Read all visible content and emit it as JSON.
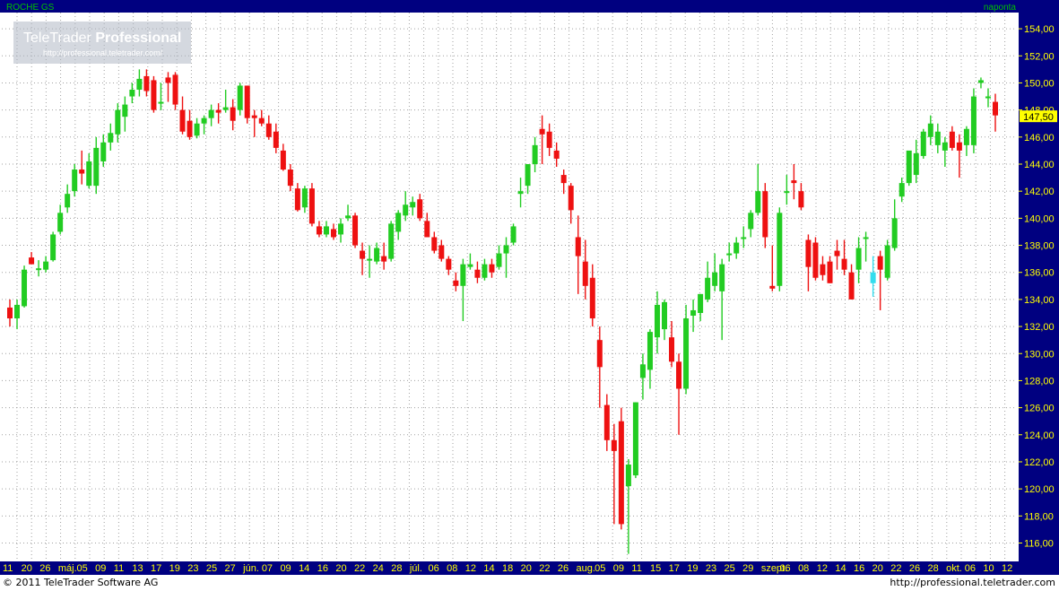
{
  "header": {
    "symbol": "ROCHE GS",
    "period": "naponta"
  },
  "watermark": {
    "brand_light": "TeleTrader",
    "brand_bold": "Professional",
    "url": "http://professional.teletrader.com/"
  },
  "footer": {
    "copyright": "© 2011  TeleTrader Software AG",
    "url": "http://professional.teletrader.com"
  },
  "colors": {
    "background": "#ffffff",
    "frame": "#000080",
    "axis_text": "#ffff00",
    "header_text": "#00c000",
    "up": "#22cc22",
    "down": "#ee1111",
    "last": "#33ddee",
    "grid": "#a0a0a0",
    "last_price_bg": "#ffff00"
  },
  "chart_data": {
    "type": "candlestick",
    "title": "ROCHE GS",
    "ylim": [
      115,
      155
    ],
    "y_ticks": [
      "154,00",
      "152,00",
      "150,00",
      "148,00",
      "146,00",
      "144,00",
      "142,00",
      "140,00",
      "138,00",
      "136,00",
      "134,00",
      "132,00",
      "130,00",
      "128,00",
      "126,00",
      "124,00",
      "122,00",
      "120,00",
      "118,00",
      "116,00"
    ],
    "x_ticks": [
      "11",
      "20",
      "26",
      "máj.",
      "05",
      "09",
      "11",
      "13",
      "17",
      "19",
      "23",
      "25",
      "27",
      "jún.",
      "07",
      "09",
      "14",
      "16",
      "20",
      "22",
      "24",
      "28",
      "júl.",
      "06",
      "08",
      "12",
      "14",
      "18",
      "20",
      "22",
      "26",
      "aug.",
      "05",
      "09",
      "11",
      "15",
      "17",
      "19",
      "23",
      "25",
      "29",
      "szept.",
      "06",
      "08",
      "12",
      "14",
      "16",
      "20",
      "22",
      "26",
      "28",
      "okt.",
      "06",
      "10",
      "12"
    ],
    "last_price": "147,50",
    "grid": true,
    "candles": [
      [
        133.4,
        134.0,
        132.0,
        132.6
      ],
      [
        132.6,
        134.0,
        131.8,
        133.6
      ],
      [
        133.5,
        136.5,
        133.4,
        136.2
      ],
      [
        137.1,
        137.5,
        136.6,
        136.6
      ],
      [
        136.3,
        136.9,
        135.7,
        136.3
      ],
      [
        136.2,
        137.2,
        136.0,
        136.8
      ],
      [
        136.9,
        139.0,
        136.8,
        138.8
      ],
      [
        139.0,
        141.0,
        138.8,
        140.4
      ],
      [
        140.8,
        142.5,
        140.4,
        141.8
      ],
      [
        142.0,
        144.0,
        141.6,
        143.6
      ],
      [
        143.6,
        145.0,
        142.5,
        143.3
      ],
      [
        142.4,
        144.8,
        142.2,
        144.2
      ],
      [
        142.4,
        146.0,
        141.8,
        145.2
      ],
      [
        144.2,
        146.2,
        143.8,
        145.6
      ],
      [
        145.6,
        147.0,
        145.0,
        146.3
      ],
      [
        146.2,
        148.5,
        145.6,
        148.0
      ],
      [
        147.5,
        149.0,
        146.4,
        148.4
      ],
      [
        149.0,
        150.0,
        148.5,
        149.5
      ],
      [
        149.5,
        151.0,
        149.0,
        150.3
      ],
      [
        150.5,
        151.0,
        149.0,
        149.4
      ],
      [
        150.2,
        150.5,
        147.8,
        148.0
      ],
      [
        148.6,
        150.0,
        148.0,
        148.6
      ],
      [
        150.4,
        150.8,
        148.6,
        150.0
      ],
      [
        150.6,
        150.8,
        148.0,
        148.4
      ],
      [
        148.0,
        149.0,
        146.2,
        146.4
      ],
      [
        147.2,
        148.0,
        145.8,
        146.0
      ],
      [
        146.1,
        147.4,
        145.9,
        147.0
      ],
      [
        147.0,
        147.6,
        146.2,
        147.4
      ],
      [
        147.4,
        148.4,
        146.8,
        148.0
      ],
      [
        148.0,
        148.5,
        147.0,
        147.8
      ],
      [
        148.0,
        149.5,
        147.8,
        148.2
      ],
      [
        148.2,
        148.8,
        146.5,
        147.2
      ],
      [
        148.0,
        150.0,
        147.6,
        149.8
      ],
      [
        149.8,
        149.8,
        147.0,
        147.4
      ],
      [
        147.6,
        148.0,
        146.0,
        147.4
      ],
      [
        147.4,
        148.0,
        146.8,
        147.0
      ],
      [
        147.0,
        147.6,
        145.8,
        146.0
      ],
      [
        146.4,
        147.0,
        144.8,
        145.2
      ],
      [
        145.0,
        145.5,
        143.5,
        143.6
      ],
      [
        143.6,
        144.0,
        142.0,
        142.4
      ],
      [
        142.2,
        142.6,
        140.5,
        140.6
      ],
      [
        140.8,
        142.4,
        140.4,
        142.2
      ],
      [
        142.2,
        142.6,
        139.4,
        139.6
      ],
      [
        139.4,
        139.8,
        138.6,
        138.8
      ],
      [
        138.8,
        139.8,
        138.6,
        139.4
      ],
      [
        139.2,
        139.6,
        138.4,
        138.6
      ],
      [
        138.8,
        140.0,
        138.2,
        139.6
      ],
      [
        140.0,
        141.0,
        139.8,
        140.2
      ],
      [
        140.2,
        140.4,
        137.8,
        138.0
      ],
      [
        137.6,
        138.2,
        135.8,
        137.0
      ],
      [
        137.0,
        138.0,
        135.6,
        137.0
      ],
      [
        136.8,
        138.2,
        136.6,
        137.8
      ],
      [
        137.2,
        138.2,
        136.2,
        136.8
      ],
      [
        137.0,
        139.8,
        136.8,
        139.6
      ],
      [
        139.0,
        140.6,
        138.4,
        140.4
      ],
      [
        140.2,
        142.0,
        139.8,
        141.0
      ],
      [
        140.8,
        141.6,
        140.2,
        141.2
      ],
      [
        141.4,
        141.8,
        139.8,
        140.0
      ],
      [
        139.8,
        140.4,
        138.6,
        138.6
      ],
      [
        138.6,
        139.0,
        137.4,
        137.6
      ],
      [
        138.0,
        138.4,
        136.8,
        137.0
      ],
      [
        137.0,
        137.2,
        135.8,
        136.2
      ],
      [
        135.4,
        136.0,
        134.6,
        135.0
      ],
      [
        135.0,
        137.0,
        132.4,
        136.6
      ],
      [
        136.4,
        137.4,
        136.2,
        136.6
      ],
      [
        136.2,
        136.8,
        135.2,
        135.6
      ],
      [
        135.6,
        137.0,
        135.4,
        136.6
      ],
      [
        136.6,
        137.0,
        135.6,
        136.0
      ],
      [
        136.4,
        138.0,
        136.2,
        137.4
      ],
      [
        137.4,
        138.6,
        135.6,
        138.0
      ],
      [
        138.2,
        139.6,
        138.0,
        139.4
      ],
      [
        141.8,
        143.0,
        140.8,
        142.0
      ],
      [
        142.4,
        144.0,
        141.8,
        144.0
      ],
      [
        144.0,
        146.0,
        143.4,
        145.4
      ],
      [
        146.6,
        147.6,
        144.0,
        146.2
      ],
      [
        146.4,
        147.0,
        144.6,
        145.2
      ],
      [
        145.0,
        145.6,
        143.8,
        144.4
      ],
      [
        143.2,
        143.6,
        141.8,
        142.6
      ],
      [
        142.4,
        142.6,
        139.6,
        140.6
      ],
      [
        138.6,
        140.2,
        134.4,
        137.2
      ],
      [
        136.8,
        138.4,
        134.0,
        135.0
      ],
      [
        135.6,
        136.6,
        132.0,
        132.6
      ],
      [
        131.0,
        132.0,
        126.0,
        129.0
      ],
      [
        126.2,
        127.0,
        122.8,
        123.6
      ],
      [
        123.6,
        124.8,
        117.4,
        122.8
      ],
      [
        125.0,
        126.0,
        117.0,
        117.4
      ],
      [
        120.2,
        122.2,
        115.2,
        121.8
      ],
      [
        121.0,
        126.4,
        120.8,
        126.4
      ],
      [
        128.2,
        130.0,
        126.6,
        129.2
      ],
      [
        128.8,
        131.8,
        127.4,
        131.6
      ],
      [
        131.2,
        134.6,
        130.0,
        133.6
      ],
      [
        131.8,
        134.0,
        131.0,
        133.8
      ],
      [
        131.2,
        132.4,
        129.0,
        129.4
      ],
      [
        129.4,
        130.0,
        124.0,
        127.4
      ],
      [
        127.4,
        133.6,
        127.0,
        132.6
      ],
      [
        132.8,
        134.0,
        131.6,
        133.2
      ],
      [
        133.0,
        134.4,
        132.4,
        134.4
      ],
      [
        134.0,
        136.8,
        133.8,
        135.6
      ],
      [
        135.0,
        137.4,
        134.6,
        136.0
      ],
      [
        134.6,
        137.0,
        131.0,
        136.6
      ],
      [
        137.4,
        138.2,
        136.8,
        137.4
      ],
      [
        137.4,
        138.6,
        137.0,
        138.2
      ],
      [
        138.6,
        139.4,
        137.8,
        138.6
      ],
      [
        139.2,
        140.6,
        138.6,
        140.4
      ],
      [
        140.4,
        144.0,
        140.2,
        142.0
      ],
      [
        142.0,
        142.6,
        137.8,
        138.6
      ],
      [
        135.0,
        138.0,
        134.6,
        134.8
      ],
      [
        135.0,
        140.8,
        134.6,
        140.4
      ],
      [
        142.0,
        143.2,
        141.0,
        142.0
      ],
      [
        142.8,
        144.0,
        141.4,
        142.6
      ],
      [
        142.0,
        142.6,
        140.6,
        140.8
      ],
      [
        138.4,
        138.8,
        134.6,
        136.4
      ],
      [
        138.2,
        138.6,
        135.4,
        135.6
      ],
      [
        136.6,
        137.2,
        135.4,
        135.8
      ],
      [
        136.8,
        137.2,
        135.2,
        135.2
      ],
      [
        137.6,
        138.4,
        136.2,
        137.2
      ],
      [
        137.0,
        138.4,
        135.8,
        136.2
      ],
      [
        136.0,
        136.6,
        134.0,
        134.0
      ],
      [
        136.2,
        138.6,
        135.2,
        137.8
      ],
      [
        138.6,
        139.0,
        136.8,
        138.6
      ],
      [
        136.0,
        137.2,
        134.2,
        135.2
      ],
      [
        137.2,
        137.6,
        133.2,
        136.2
      ],
      [
        135.6,
        138.4,
        135.4,
        138.0
      ],
      [
        137.8,
        141.4,
        137.6,
        140.0
      ],
      [
        141.6,
        143.0,
        141.2,
        142.6
      ],
      [
        142.6,
        144.4,
        142.4,
        145.0
      ],
      [
        143.2,
        145.8,
        142.6,
        144.8
      ],
      [
        144.6,
        146.6,
        144.4,
        146.4
      ],
      [
        146.0,
        147.6,
        145.4,
        147.0
      ],
      [
        145.4,
        147.0,
        144.8,
        146.4
      ],
      [
        145.0,
        146.0,
        143.8,
        145.6
      ],
      [
        146.4,
        146.8,
        145.0,
        145.2
      ],
      [
        145.6,
        146.2,
        143.0,
        145.0
      ],
      [
        145.4,
        146.8,
        144.6,
        146.6
      ],
      [
        145.4,
        149.6,
        144.8,
        149.0
      ],
      [
        150.0,
        150.4,
        149.6,
        150.2
      ],
      [
        149.0,
        149.6,
        148.2,
        149.0
      ],
      [
        148.6,
        149.2,
        146.4,
        147.6
      ]
    ]
  }
}
